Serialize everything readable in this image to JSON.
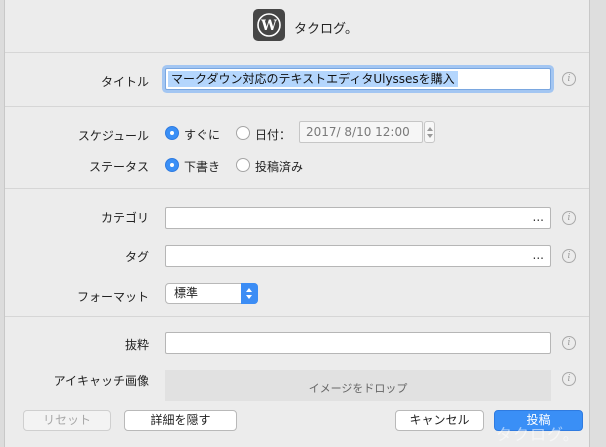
{
  "app": {
    "title": "タクログ。",
    "icon": "wordpress-icon"
  },
  "fields": {
    "title_label": "タイトル",
    "title_value": "マークダウン対応のテキストエディタUlyssesを購入",
    "schedule_label": "スケジュール",
    "schedule_now": "すぐに",
    "schedule_date_label": "日付：",
    "schedule_date_value": "2017/ 8/10 12:00",
    "status_label": "ステータス",
    "status_draft": "下書き",
    "status_published": "投稿済み",
    "category_label": "カテゴリ",
    "category_value": "",
    "category_more": "...",
    "tag_label": "タグ",
    "tag_value": "",
    "tag_more": "...",
    "format_label": "フォーマット",
    "format_value": "標準",
    "excerpt_label": "抜粋",
    "excerpt_value": "",
    "featured_image_label": "アイキャッチ画像",
    "featured_image_drop": "イメージをドロップ"
  },
  "buttons": {
    "reset": "リセット",
    "hide_details": "詳細を隠す",
    "cancel": "キャンセル",
    "post": "投稿"
  },
  "watermark": "タクログ。",
  "colors": {
    "accent": "#3a8ff6",
    "selection": "#b4d6fd",
    "background": "#ececec"
  }
}
